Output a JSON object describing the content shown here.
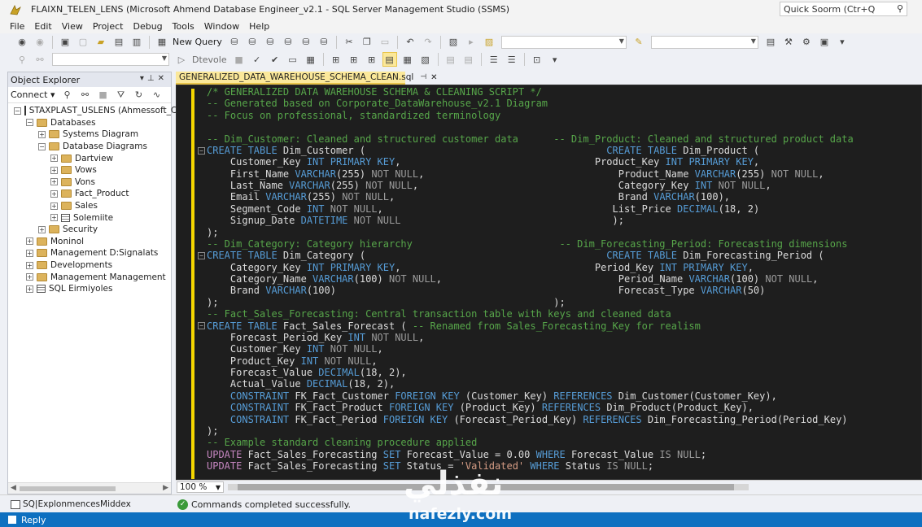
{
  "window": {
    "title": "FLAIXN_TELEN_LENS (Microsoft Ahmend Database Engineer_v2.1 - SQL Server Management Studio (SSMS)",
    "quick_launch": "Quick Soorm (Ctr+Q"
  },
  "menu": [
    "File",
    "Edit",
    "View",
    "Project",
    "Debug",
    "Tools",
    "Window",
    "Help"
  ],
  "toolbar": {
    "new_query": "New Query",
    "execute": "Dtevole"
  },
  "object_explorer": {
    "title": "Object Explorer",
    "connect": "Connect",
    "tree": [
      {
        "label": "STAXPLAST_USLENS (Ahmessoft_Con",
        "toggle": "−",
        "icon": "server",
        "indent": 0
      },
      {
        "label": "Databases",
        "toggle": "−",
        "icon": "folder",
        "indent": 1
      },
      {
        "label": "Systems Diagram",
        "toggle": "+",
        "icon": "folder",
        "indent": 2
      },
      {
        "label": "Database Diagrams",
        "toggle": "−",
        "icon": "folder",
        "indent": 2
      },
      {
        "label": "Dartview",
        "toggle": "+",
        "icon": "folder",
        "indent": 3
      },
      {
        "label": "Vows",
        "toggle": "+",
        "icon": "folder",
        "indent": 3
      },
      {
        "label": "Vons",
        "toggle": "+",
        "icon": "folder",
        "indent": 3
      },
      {
        "label": "Fact_Product",
        "toggle": "+",
        "icon": "folder",
        "indent": 3
      },
      {
        "label": "Sales",
        "toggle": "+",
        "icon": "folder",
        "indent": 3
      },
      {
        "label": "Solemiite",
        "toggle": "+",
        "icon": "table",
        "indent": 3
      },
      {
        "label": "Security",
        "toggle": "+",
        "icon": "folder",
        "indent": 2
      },
      {
        "label": "Moninol",
        "toggle": "+",
        "icon": "folder",
        "indent": 1
      },
      {
        "label": "Management D:Signalats",
        "toggle": "+",
        "icon": "folder",
        "indent": 1
      },
      {
        "label": "Developments",
        "toggle": "+",
        "icon": "folder",
        "indent": 1
      },
      {
        "label": "Management Management",
        "toggle": "+",
        "icon": "folder",
        "indent": 1
      },
      {
        "label": "SQL Eirmiyoles",
        "toggle": "+",
        "icon": "table",
        "indent": 1
      }
    ]
  },
  "editor": {
    "tab_label": "GENERALIZED_DATA_WAREHOUSE_SCHEMA_CLEAN.sql",
    "zoom": "100 %",
    "lines": [
      [
        [
          "c",
          "/* GENERALIZED DATA WAREHOUSE SCHEMA & CLEANING SCRIPT */"
        ]
      ],
      [
        [
          "c",
          "-- Generated based on Corporate_DataWarehouse_v2.1 Diagram"
        ]
      ],
      [
        [
          "c",
          "-- Focus on professional, standardized terminology"
        ]
      ],
      [],
      [
        [
          "c",
          "-- Dim_Customer: Cleaned and structured customer data      -- Dim_Product: Cleaned and structured product data"
        ]
      ],
      [
        [
          "k",
          "CREATE TABLE"
        ],
        [
          "t",
          " Dim_Customer (                                         "
        ],
        [
          "k",
          "CREATE TABLE"
        ],
        [
          "t",
          " Dim_Product ("
        ]
      ],
      [
        [
          "t",
          "    Customer_Key "
        ],
        [
          "k",
          "INT PRIMARY KEY"
        ],
        [
          "t",
          ",                                 Product_Key "
        ],
        [
          "k",
          "INT PRIMARY KEY"
        ],
        [
          "t",
          ","
        ]
      ],
      [
        [
          "t",
          "    First_Name "
        ],
        [
          "k",
          "VARCHAR"
        ],
        [
          "t",
          "(255) "
        ],
        [
          "g",
          "NOT NULL"
        ],
        [
          "t",
          ",                                 Product_Name "
        ],
        [
          "k",
          "VARCHAR"
        ],
        [
          "t",
          "(255) "
        ],
        [
          "g",
          "NOT NULL"
        ],
        [
          "t",
          ","
        ]
      ],
      [
        [
          "t",
          "    Last_Name "
        ],
        [
          "k",
          "VARCHAR"
        ],
        [
          "t",
          "(255) "
        ],
        [
          "g",
          "NOT NULL"
        ],
        [
          "t",
          ",                                  Category_Key "
        ],
        [
          "k",
          "INT"
        ],
        [
          "t",
          " "
        ],
        [
          "g",
          "NOT NULL"
        ],
        [
          "t",
          ","
        ]
      ],
      [
        [
          "t",
          "    Email "
        ],
        [
          "k",
          "VARCHAR"
        ],
        [
          "t",
          "(255) "
        ],
        [
          "g",
          "NOT NULL"
        ],
        [
          "t",
          ",                                      Brand "
        ],
        [
          "k",
          "VARCHAR"
        ],
        [
          "t",
          "(100),"
        ]
      ],
      [
        [
          "t",
          "    Segment_Code "
        ],
        [
          "k",
          "INT"
        ],
        [
          "t",
          " "
        ],
        [
          "g",
          "NOT NULL"
        ],
        [
          "t",
          ",                                       List_Price "
        ],
        [
          "k",
          "DECIMAL"
        ],
        [
          "t",
          "(18, 2)"
        ]
      ],
      [
        [
          "t",
          "    Signup_Date "
        ],
        [
          "k",
          "DATETIME"
        ],
        [
          "t",
          " "
        ],
        [
          "g",
          "NOT NULL"
        ],
        [
          "t",
          "                                    );"
        ]
      ],
      [
        [
          "t",
          ");"
        ]
      ],
      [
        [
          "c",
          "-- Dim_Category: Category hierarchy                         -- Dim_Forecasting_Period: Forecasting dimensions"
        ]
      ],
      [
        [
          "k",
          "CREATE TABLE"
        ],
        [
          "t",
          " Dim_Category (                                         "
        ],
        [
          "k",
          "CREATE TABLE"
        ],
        [
          "t",
          " Dim_Forecasting_Period ("
        ]
      ],
      [
        [
          "t",
          "    Category_Key "
        ],
        [
          "k",
          "INT PRIMARY KEY"
        ],
        [
          "t",
          ",                                 Period_Key "
        ],
        [
          "k",
          "INT PRIMARY KEY"
        ],
        [
          "t",
          ","
        ]
      ],
      [
        [
          "t",
          "    Category_Name "
        ],
        [
          "k",
          "VARCHAR"
        ],
        [
          "t",
          "(100) "
        ],
        [
          "g",
          "NOT NULL"
        ],
        [
          "t",
          ",                              Period_Name "
        ],
        [
          "k",
          "VARCHAR"
        ],
        [
          "t",
          "(100) "
        ],
        [
          "g",
          "NOT NULL"
        ],
        [
          "t",
          ","
        ]
      ],
      [
        [
          "t",
          "    Brand "
        ],
        [
          "k",
          "VARCHAR"
        ],
        [
          "t",
          "(100)                                                Forecast_Type "
        ],
        [
          "k",
          "VARCHAR"
        ],
        [
          "t",
          "(50)"
        ]
      ],
      [
        [
          "t",
          ");                                                         );"
        ]
      ],
      [
        [
          "c",
          "-- Fact_Sales_Forecasting: Central transaction table with keys and cleaned data"
        ]
      ],
      [
        [
          "k",
          "CREATE TABLE"
        ],
        [
          "t",
          " Fact_Sales_Forecast ( "
        ],
        [
          "c",
          "-- Renamed from Sales_Forecasting_Key for realism"
        ]
      ],
      [
        [
          "t",
          "    Forecast_Period_Key "
        ],
        [
          "k",
          "INT"
        ],
        [
          "t",
          " "
        ],
        [
          "g",
          "NOT NULL"
        ],
        [
          "t",
          ","
        ]
      ],
      [
        [
          "t",
          "    Customer_Key "
        ],
        [
          "k",
          "INT"
        ],
        [
          "t",
          " "
        ],
        [
          "g",
          "NOT NULL"
        ],
        [
          "t",
          ","
        ]
      ],
      [
        [
          "t",
          "    Product_Key "
        ],
        [
          "k",
          "INT"
        ],
        [
          "t",
          " "
        ],
        [
          "g",
          "NOT NULL"
        ],
        [
          "t",
          ","
        ]
      ],
      [
        [
          "t",
          "    Forecast_Value "
        ],
        [
          "k",
          "DECIMAL"
        ],
        [
          "t",
          "(18, 2),"
        ]
      ],
      [
        [
          "t",
          "    Actual_Value "
        ],
        [
          "k",
          "DECIMAL"
        ],
        [
          "t",
          "(18, 2),"
        ]
      ],
      [
        [
          "t",
          "    "
        ],
        [
          "k",
          "CONSTRAINT"
        ],
        [
          "t",
          " FK_Fact_Customer "
        ],
        [
          "k",
          "FOREIGN KEY"
        ],
        [
          "t",
          " (Customer_Key) "
        ],
        [
          "k",
          "REFERENCES"
        ],
        [
          "t",
          " Dim_Customer(Customer_Key),"
        ]
      ],
      [
        [
          "t",
          "    "
        ],
        [
          "k",
          "CONSTRAINT"
        ],
        [
          "t",
          " FK_Fact_Product "
        ],
        [
          "k",
          "FOREIGN KEY"
        ],
        [
          "t",
          " (Product_Key) "
        ],
        [
          "k",
          "REFERENCES"
        ],
        [
          "t",
          " Dim_Product(Product_Key),"
        ]
      ],
      [
        [
          "t",
          "    "
        ],
        [
          "k",
          "CONSTRAINT"
        ],
        [
          "t",
          " FK_Fact_Period "
        ],
        [
          "k",
          "FOREIGN KEY"
        ],
        [
          "t",
          " (Forecast_Period_Key) "
        ],
        [
          "k",
          "REFERENCES"
        ],
        [
          "t",
          " Dim_Forecasting_Period(Period_Key)"
        ]
      ],
      [
        [
          "t",
          ");"
        ]
      ],
      [
        [
          "c",
          "-- Example standard cleaning procedure applied"
        ]
      ],
      [
        [
          "r",
          "UPDATE"
        ],
        [
          "t",
          " Fact_Sales_Forecasting "
        ],
        [
          "k",
          "SET"
        ],
        [
          "t",
          " Forecast_Value = 0.00 "
        ],
        [
          "k",
          "WHERE"
        ],
        [
          "t",
          " Forecast_Value "
        ],
        [
          "g",
          "IS NULL"
        ],
        [
          "t",
          ";"
        ]
      ],
      [
        [
          "r",
          "UPDATE"
        ],
        [
          "t",
          " Fact_Sales_Forecasting "
        ],
        [
          "k",
          "SET"
        ],
        [
          "t",
          " Status = "
        ],
        [
          "s",
          "'Validated'"
        ],
        [
          "t",
          " "
        ],
        [
          "k",
          "WHERE"
        ],
        [
          "t",
          " Status "
        ],
        [
          "g",
          "IS NULL"
        ],
        [
          "t",
          ";"
        ]
      ]
    ]
  },
  "results": {
    "tab_label": "SQ|ExplonmencesMiddex",
    "message": "Commands completed successfully."
  },
  "statusbar": {
    "text": "Reply"
  },
  "watermark": {
    "arabic": "نفذلي",
    "latin": "nafezly.com"
  },
  "colors": {
    "editor_bg": "#1e1e1e",
    "keyword": "#569cd6",
    "comment": "#57a64a",
    "string": "#d69d85",
    "statusbar": "#0e70c0",
    "tab_active": "#fbe89a"
  }
}
